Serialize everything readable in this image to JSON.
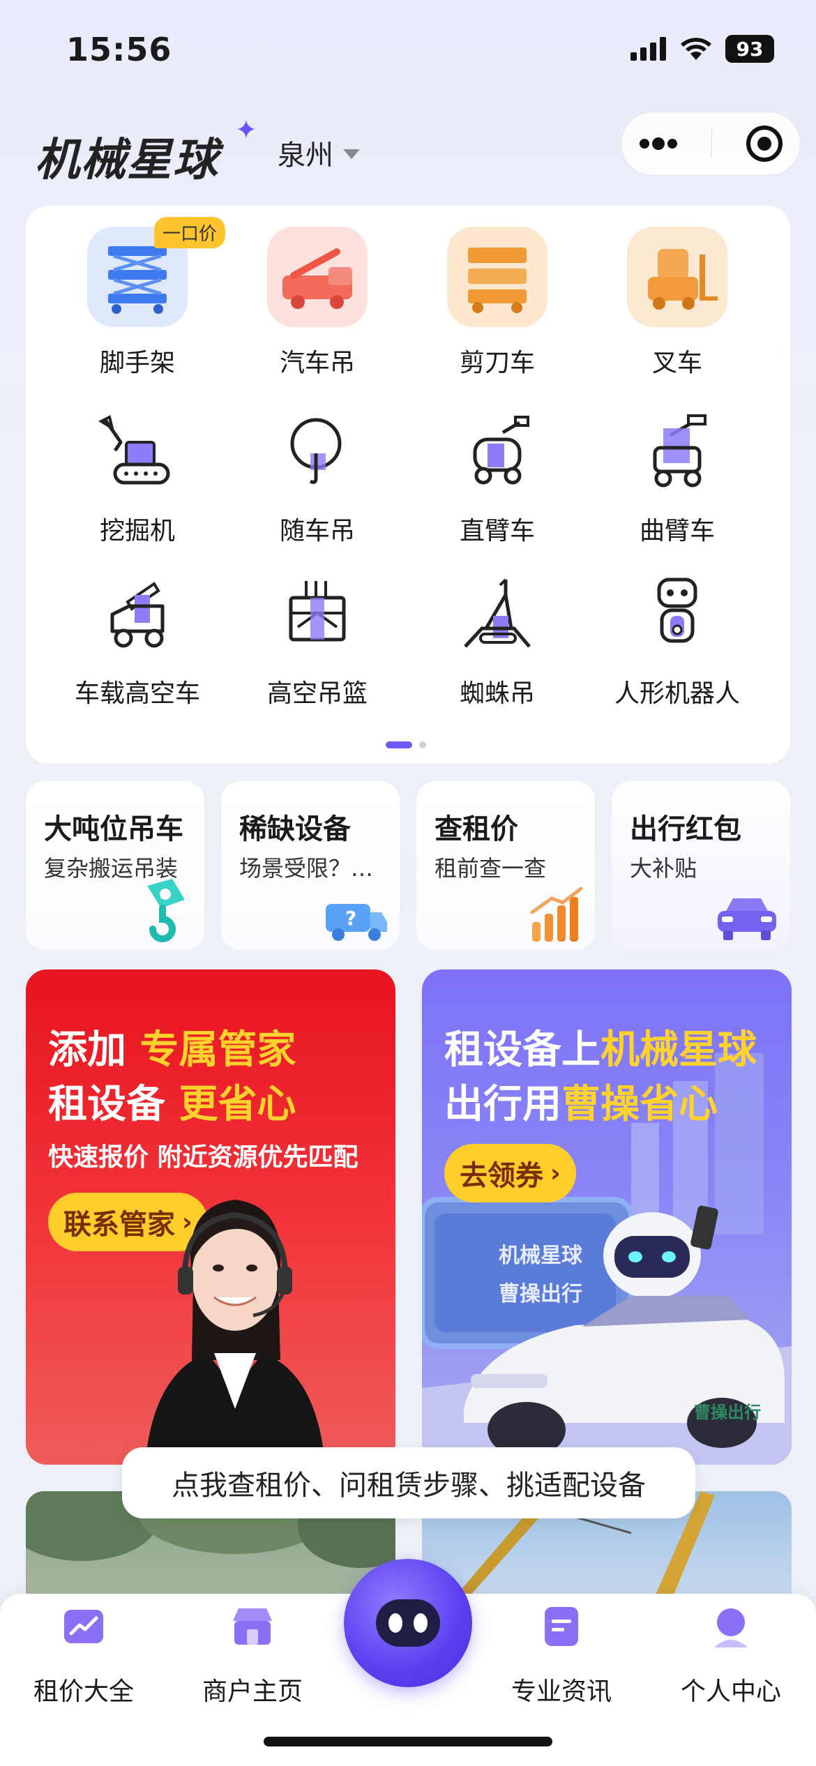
{
  "status_bar": {
    "time": "15:56",
    "battery": "93"
  },
  "header": {
    "logo": "机械星球",
    "city": "泉州"
  },
  "categories": [
    {
      "label": "脚手架",
      "badge": "一口价",
      "icon": "scaffold-icon"
    },
    {
      "label": "汽车吊",
      "icon": "truck-crane-icon"
    },
    {
      "label": "剪刀车",
      "icon": "scissor-lift-icon"
    },
    {
      "label": "叉车",
      "icon": "forklift-icon"
    },
    {
      "label": "挖掘机",
      "icon": "excavator-icon"
    },
    {
      "label": "随车吊",
      "icon": "truck-mounted-crane-icon"
    },
    {
      "label": "直臂车",
      "icon": "straight-boom-icon"
    },
    {
      "label": "曲臂车",
      "icon": "articulated-boom-icon"
    },
    {
      "label": "车载高空车",
      "icon": "aerial-truck-icon"
    },
    {
      "label": "高空吊篮",
      "icon": "gondola-icon"
    },
    {
      "label": "蜘蛛吊",
      "icon": "spider-crane-icon"
    },
    {
      "label": "人形机器人",
      "icon": "humanoid-robot-icon"
    }
  ],
  "quick_cards": [
    {
      "title": "大吨位吊车",
      "sub": "复杂搬运吊装",
      "icon": "hook-icon"
    },
    {
      "title": "稀缺设备",
      "sub": "场景受限？找它",
      "icon": "mystery-truck-icon"
    },
    {
      "title": "查租价",
      "sub": "租前查一查",
      "icon": "bar-chart-icon"
    },
    {
      "title": "出行红包",
      "sub": "大补贴",
      "icon": "car-icon"
    }
  ],
  "banner_left": {
    "line1_a": "添加 ",
    "line1_b": "专属管家",
    "line2_a": "租设备 ",
    "line2_b": "更省心",
    "sub": "快速报价 附近资源优先匹配",
    "button": "联系管家"
  },
  "banner_right": {
    "line1_a": "租设备上",
    "line1_b": "机械星球",
    "line2_a": "出行用",
    "line2_b": "曹操省心",
    "button": "去领券",
    "sign_brand": "机械星球",
    "sign_partner": "曹操出行",
    "car_brand": "曹操出行"
  },
  "assistant_tip": "点我查租价、问租赁步骤、挑适配设备",
  "tabbar": [
    {
      "label": "租价大全",
      "icon": "price-chart-icon"
    },
    {
      "label": "商户主页",
      "icon": "store-icon"
    },
    {
      "label": "专业资讯",
      "icon": "news-icon"
    },
    {
      "label": "个人中心",
      "icon": "profile-icon"
    }
  ],
  "colors": {
    "accent": "#6b5cf6",
    "badge": "#ffc42e",
    "banner_red": "#e8131f",
    "banner_purple": "#7d72f8"
  }
}
